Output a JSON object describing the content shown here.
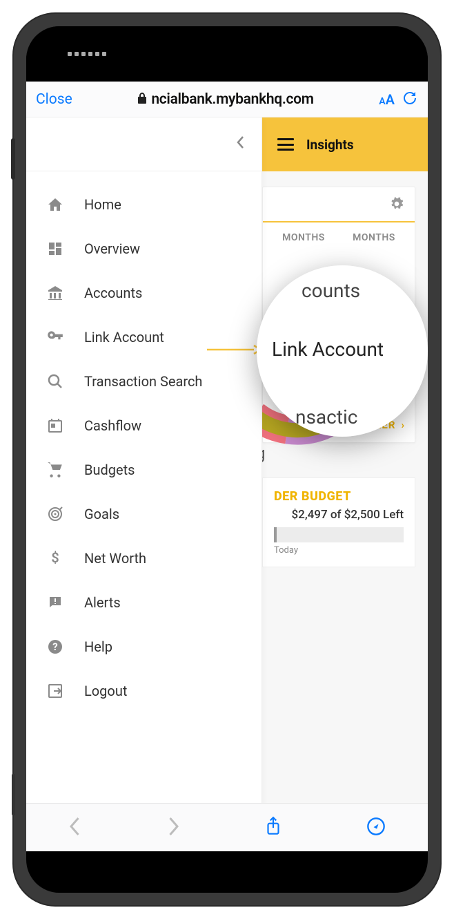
{
  "browser": {
    "close_label": "Close",
    "url": "ncialbank.mybankhq.com"
  },
  "header": {
    "title": "Insights"
  },
  "sidebar": {
    "items": [
      {
        "icon": "home",
        "label": "Home"
      },
      {
        "icon": "dashboard",
        "label": "Overview"
      },
      {
        "icon": "bank",
        "label": "Accounts"
      },
      {
        "icon": "key",
        "label": "Link Account"
      },
      {
        "icon": "search",
        "label": "Transaction Search"
      },
      {
        "icon": "calendar",
        "label": "Cashflow"
      },
      {
        "icon": "cart",
        "label": "Budgets"
      },
      {
        "icon": "target",
        "label": "Goals"
      },
      {
        "icon": "dollar",
        "label": "Net Worth"
      },
      {
        "icon": "alert",
        "label": "Alerts"
      },
      {
        "icon": "help",
        "label": "Help"
      },
      {
        "icon": "logout",
        "label": "Logout"
      }
    ]
  },
  "bubble": {
    "line1": "counts",
    "line2": "Link Account",
    "line3": "nsactic"
  },
  "main": {
    "tabs": {
      "tab1": "MONTHS",
      "tab2": "MONTHS"
    },
    "fragment_counts": "counts",
    "fragment_g": "g",
    "view_analyzer": "VIEW ANALYZER",
    "budget_title": "DER BUDGET",
    "budget_left": "$2,497 of $2,500 Left",
    "budget_today": "Today"
  },
  "chart_data": {
    "type": "pie",
    "title": "",
    "series": [
      {
        "name": "segment-purple",
        "value": 40,
        "color": "#c98bcf"
      },
      {
        "name": "segment-pink",
        "value": 8,
        "color": "#f0717e"
      },
      {
        "name": "segment-olive",
        "value": 6,
        "color": "#b6a621"
      },
      {
        "name": "remaining",
        "value": 46,
        "color": "#ffffff"
      }
    ]
  },
  "colors": {
    "accent": "#f6c33c",
    "link": "#0a7aff",
    "analyzer": "#f0b400"
  }
}
